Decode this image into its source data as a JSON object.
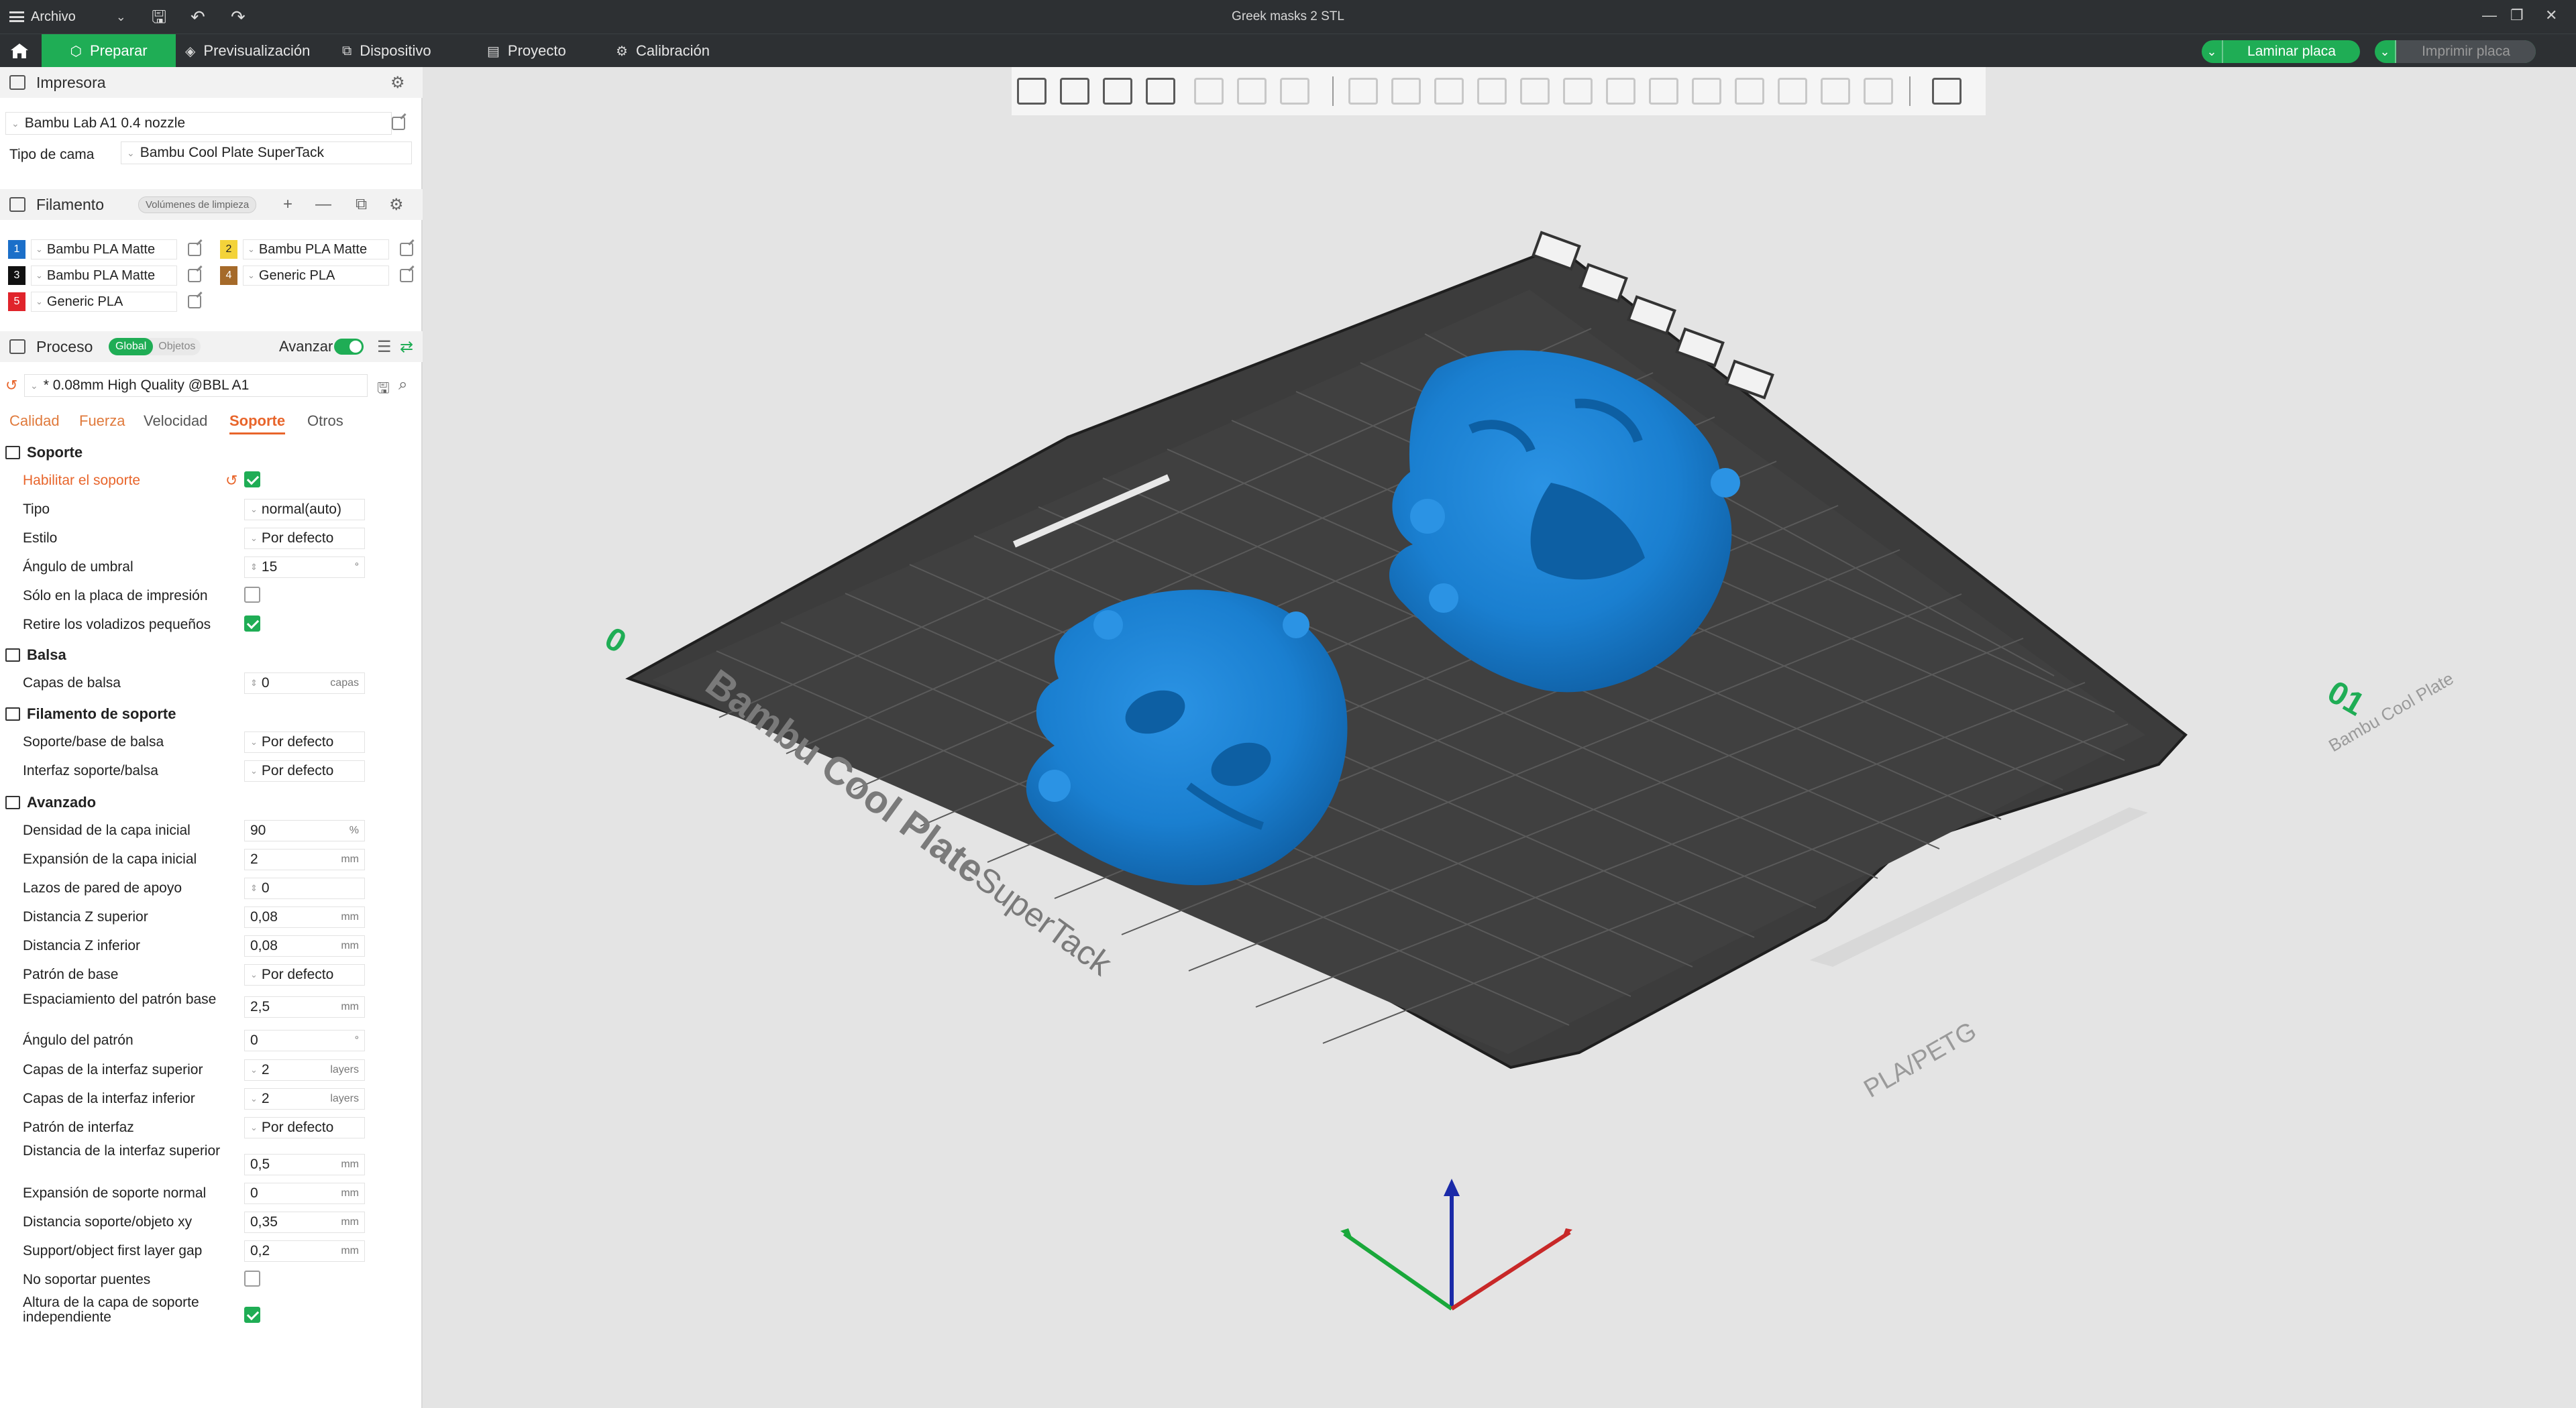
{
  "titlebar": {
    "menu_label": "Archivo",
    "window_title": "Greek masks 2 STL"
  },
  "topbar": {
    "tabs": [
      {
        "label": "Preparar",
        "icon": "prepare-icon",
        "active": true
      },
      {
        "label": "Previsualización",
        "icon": "preview-icon"
      },
      {
        "label": "Dispositivo",
        "icon": "device-icon"
      },
      {
        "label": "Proyecto",
        "icon": "project-icon"
      },
      {
        "label": "Calibración",
        "icon": "calibration-icon"
      }
    ],
    "slice_label": "Laminar placa",
    "print_label": "Imprimir placa"
  },
  "printer": {
    "section_title": "Impresora",
    "printer_name": "Bambu Lab A1 0.4 nozzle",
    "bed_type_label": "Tipo de cama",
    "bed_type_value": "Bambu Cool Plate SuperTack"
  },
  "filament": {
    "section_title": "Filamento",
    "flush_button": "Volúmenes de limpieza",
    "items": [
      {
        "index": "1",
        "name": "Bambu PLA Matte",
        "color": "#1b6fc9"
      },
      {
        "index": "2",
        "name": "Bambu PLA Matte",
        "color": "#f3d33a"
      },
      {
        "index": "3",
        "name": "Bambu PLA Matte",
        "color": "#111111"
      },
      {
        "index": "4",
        "name": "Generic PLA",
        "color": "#a56a2a"
      },
      {
        "index": "5",
        "name": "Generic PLA",
        "color": "#e0242b"
      }
    ]
  },
  "process": {
    "section_title": "Proceso",
    "toggle_global": "Global",
    "toggle_objects": "Objetos",
    "advanced_label": "Avanzar",
    "preset": "* 0.08mm High Quality @BBL A1",
    "tabs": [
      "Calidad",
      "Fuerza",
      "Velocidad",
      "Soporte",
      "Otros"
    ],
    "active_tab": "Soporte"
  },
  "support": {
    "group_support": "Soporte",
    "enable_label": "Habilitar el soporte",
    "type_label": "Tipo",
    "type_value": "normal(auto)",
    "style_label": "Estilo",
    "style_value": "Por defecto",
    "threshold_label": "Ángulo de umbral",
    "threshold_value": "15",
    "threshold_unit": "°",
    "build_plate_only_label": "Sólo en la placa de impresión",
    "remove_small_label": "Retire los voladizos pequeños",
    "group_raft": "Balsa",
    "raft_layers_label": "Capas de balsa",
    "raft_layers_value": "0",
    "raft_layers_unit": "capas",
    "group_filament": "Filamento de soporte",
    "support_base_label": "Soporte/base de balsa",
    "support_base_value": "Por defecto",
    "support_iface_label": "Interfaz soporte/balsa",
    "support_iface_value": "Por defecto",
    "group_advanced": "Avanzado",
    "rows": [
      {
        "label": "Densidad de la capa inicial",
        "value": "90",
        "unit": "%"
      },
      {
        "label": "Expansión de la capa inicial",
        "value": "2",
        "unit": "mm"
      },
      {
        "label": "Lazos de pared de apoyo",
        "value": "0",
        "unit": ""
      },
      {
        "label": "Distancia Z superior",
        "value": "0,08",
        "unit": "mm"
      },
      {
        "label": "Distancia Z inferior",
        "value": "0,08",
        "unit": "mm"
      },
      {
        "label": "Patrón de base",
        "value": "Por defecto",
        "unit": ""
      },
      {
        "label": "Espaciamiento del patrón base",
        "value": "2,5",
        "unit": "mm"
      },
      {
        "label": "Ángulo del patrón",
        "value": "0",
        "unit": "°"
      },
      {
        "label": "Capas de la interfaz superior",
        "value": "2",
        "unit": "layers"
      },
      {
        "label": "Capas de la interfaz inferior",
        "value": "2",
        "unit": "layers"
      },
      {
        "label": "Patrón de interfaz",
        "value": "Por defecto",
        "unit": ""
      },
      {
        "label": "Distancia de la interfaz superior",
        "value": "0,5",
        "unit": "mm"
      },
      {
        "label": "Expansión de soporte normal",
        "value": "0",
        "unit": "mm"
      },
      {
        "label": "Distancia soporte/objeto xy",
        "value": "0,35",
        "unit": "mm"
      },
      {
        "label": "Support/object first layer gap",
        "value": "0,2",
        "unit": "mm"
      }
    ],
    "no_bridges_label": "No soportar puentes",
    "independent_height_label": "Altura de la capa de soporte independiente"
  },
  "plate": {
    "brand_text": "Bambu Cool Plate",
    "brand_suffix": "SuperTack",
    "material_text": "PLA/PETG",
    "plate_number": "01",
    "origin_label": "0"
  },
  "colors": {
    "accent": "#1fad55",
    "orange": "#e8652b",
    "mask": "#1a7fd0",
    "bed": "#404040"
  }
}
